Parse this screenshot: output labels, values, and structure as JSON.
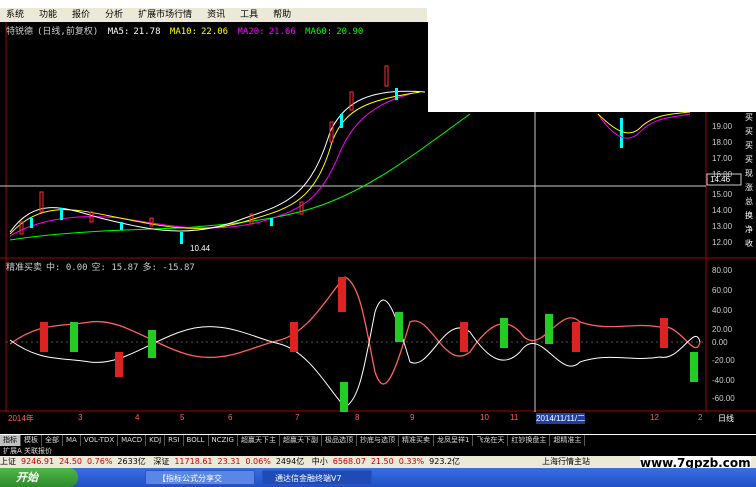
{
  "menu": [
    "系统",
    "功能",
    "报价",
    "分析",
    "扩展市场行情",
    "资讯",
    "工具",
    "帮助"
  ],
  "stock": {
    "name": "特锐德",
    "period": "(日线,前复权)"
  },
  "ma": [
    {
      "label": "MA5:",
      "value": "21.78",
      "color": "#ffffff"
    },
    {
      "label": "MA10:",
      "value": "22.06",
      "color": "#ffff00"
    },
    {
      "label": "MA20:",
      "value": "21.66",
      "color": "#ff00ff"
    },
    {
      "label": "MA60:",
      "value": "20.90",
      "color": "#00ff00"
    }
  ],
  "indicator": {
    "name": "精准买卖",
    "mid": "中: 0.00",
    "empty": "空: 15.87",
    "long": "多: -15.87"
  },
  "price_axis": [
    "19.00",
    "18.00",
    "17.00",
    "16.00",
    "15.00",
    "14.00",
    "13.00",
    "12.00"
  ],
  "current_price": "14.46",
  "low_marker": "10.44",
  "right_labels": [
    "买",
    "买",
    "买",
    "买",
    "现",
    "涨",
    "总",
    "换",
    "净",
    "收"
  ],
  "ind_axis": [
    "80.00",
    "60.00",
    "40.00",
    "20.00",
    "0.00",
    "-20.00",
    "-40.00",
    "-60.00"
  ],
  "time_axis": [
    "2014年",
    "3",
    "4",
    "5",
    "6",
    "7",
    "8",
    "9",
    "10",
    "11",
    "12",
    "2",
    "日线"
  ],
  "date_label": "2014/11/11/二",
  "tabs": [
    "指标",
    "模板",
    "全部",
    "MA",
    "VOL-TDX",
    "MACD",
    "KDJ",
    "RSI",
    "BOLL",
    "NCZIG",
    "超赢天下主",
    "超赢天下副",
    "极品选顶",
    "抄底与选顶",
    "精准买卖",
    "龙凤呈祥1",
    "飞龙在天",
    "红钞换盘主",
    "超精准主"
  ],
  "active_tab": "指标",
  "sub_tabs": [
    "扩展A",
    "关联报价"
  ],
  "status": {
    "sh_label": "上证",
    "sh_value": "9246.91",
    "sh_change": "24.50",
    "sh_pct": "0.76%",
    "sh_vol": "2633亿",
    "sz_label": "深证",
    "sz_value": "11718.61",
    "sz_change": "23.31",
    "sz_pct": "0.06%",
    "sz_vol": "2494亿",
    "zx_label": "中小",
    "zx_value": "6568.07",
    "zx_change": "21.50",
    "zx_pct": "0.33%",
    "zx_vol": "923.2亿",
    "site": "上海行情主站"
  },
  "taskbar": {
    "start": "开始",
    "items": [
      "【指标公式分享交",
      "通达信金融终端V7"
    ]
  },
  "watermark": "www.7gpzb.com"
}
